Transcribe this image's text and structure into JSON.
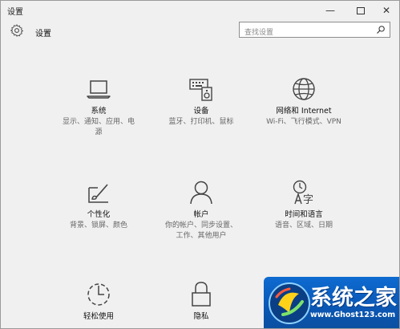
{
  "window": {
    "title": "设置",
    "minimize_glyph": "—",
    "close_glyph": "✕"
  },
  "header": {
    "title": "设置",
    "gear_icon": "gear-icon",
    "search_placeholder": "查找设置",
    "search_icon": "search-icon"
  },
  "tiles": [
    {
      "name": "系统",
      "desc": [
        "显示、通知、应用、电",
        "源"
      ],
      "icon": "laptop-icon"
    },
    {
      "name": "设备",
      "desc": [
        "蓝牙、打印机、鼠标"
      ],
      "icon": "devices-icon"
    },
    {
      "name": "网络和 Internet",
      "desc": [
        "Wi-Fi、飞行模式、VPN"
      ],
      "icon": "globe-icon"
    },
    {
      "name": "个性化",
      "desc": [
        "背景、锁屏、颜色"
      ],
      "icon": "personalization-icon"
    },
    {
      "name": "帐户",
      "desc": [
        "你的帐户、同步设置、",
        "工作、其他用户"
      ],
      "icon": "person-icon"
    },
    {
      "name": "时间和语言",
      "desc": [
        "语音、区域、日期"
      ],
      "icon": "time-language-icon"
    },
    {
      "name": "轻松使用",
      "desc": [],
      "icon": "ease-of-access-icon"
    },
    {
      "name": "隐私",
      "desc": [],
      "icon": "lock-icon"
    }
  ],
  "watermark": {
    "brand": "系统之家",
    "url": "www.Ghost123.com",
    "colors": {
      "background": "#0a58b6",
      "text": "#ffffff"
    }
  },
  "colors": {
    "window_bg": "#f0f0f0",
    "text": "#111111",
    "secondary_text": "#666666",
    "icon_stroke": "#444444"
  }
}
